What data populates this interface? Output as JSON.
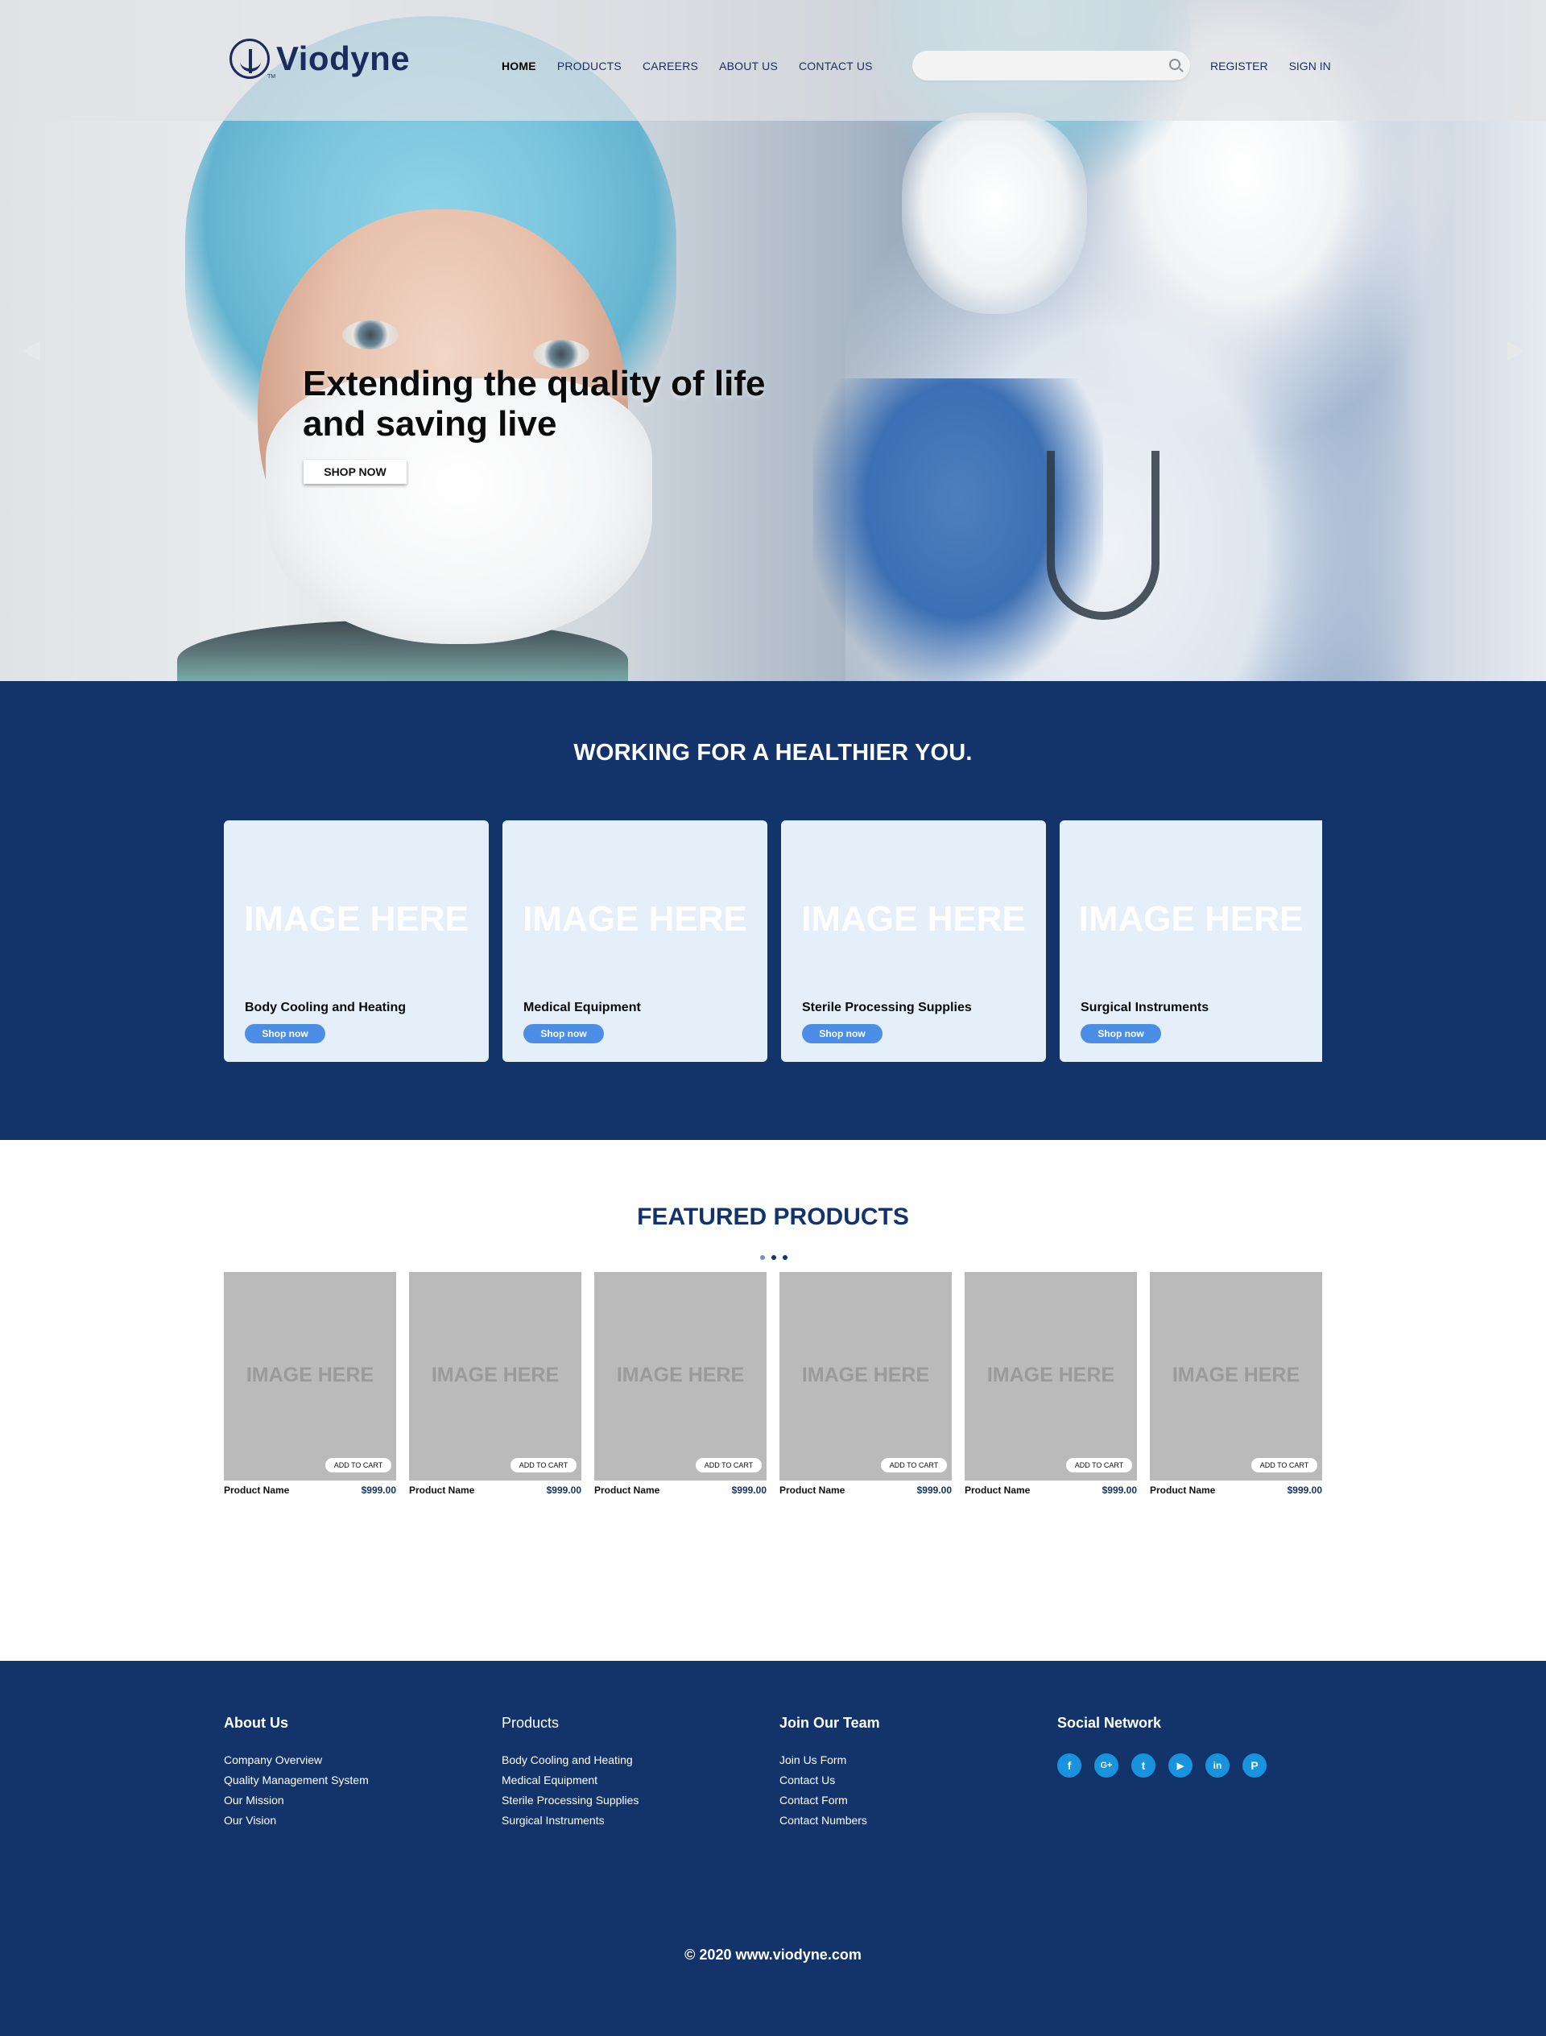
{
  "header": {
    "brand": "Viodyne",
    "nav": [
      "HOME",
      "PRODUCTS",
      "CAREERS",
      "ABOUT US",
      "CONTACT US"
    ],
    "search_placeholder": "",
    "register": "REGISTER",
    "sign_in": "SIGN IN"
  },
  "hero": {
    "title": "Extending the quality of life and saving live",
    "cta": "SHOP NOW"
  },
  "categories": {
    "heading": "WORKING FOR A HEALTHIER YOU.",
    "items": [
      {
        "image_text": "IMAGE HERE",
        "label": "Body Cooling and Heating",
        "button": "Shop now"
      },
      {
        "image_text": "IMAGE HERE",
        "label": "Medical Equipment",
        "button": "Shop now"
      },
      {
        "image_text": "IMAGE HERE",
        "label": "Sterile Processing Supplies",
        "button": "Shop now"
      },
      {
        "image_text": "IMAGE HERE",
        "label": "Surgical Instruments",
        "button": "Shop now"
      }
    ]
  },
  "featured": {
    "heading": "FEATURED PRODUCTS",
    "products": [
      {
        "image_text": "IMAGE HERE",
        "cart": "ADD TO CART",
        "name": "Product Name",
        "price": "$999.00"
      },
      {
        "image_text": "IMAGE HERE",
        "cart": "ADD TO CART",
        "name": "Product Name",
        "price": "$999.00"
      },
      {
        "image_text": "IMAGE HERE",
        "cart": "ADD TO CART",
        "name": "Product Name",
        "price": "$999.00"
      },
      {
        "image_text": "IMAGE HERE",
        "cart": "ADD TO CART",
        "name": "Product Name",
        "price": "$999.00"
      },
      {
        "image_text": "IMAGE HERE",
        "cart": "ADD TO CART",
        "name": "Product Name",
        "price": "$999.00"
      },
      {
        "image_text": "IMAGE HERE",
        "cart": "ADD TO CART",
        "name": "Product Name",
        "price": "$999.00"
      }
    ]
  },
  "footer": {
    "about": {
      "title": "About Us",
      "links": [
        "Company Overview",
        "Quality Management System",
        "Our Mission",
        "Our Vision"
      ]
    },
    "products": {
      "title": "Products",
      "links": [
        "Body Cooling and Heating",
        "Medical Equipment",
        "Sterile Processing Supplies",
        "Surgical Instruments"
      ]
    },
    "team": {
      "title": "Join Our Team",
      "links": [
        "Join Us Form",
        "Contact Us",
        "Contact Form",
        "Contact Numbers"
      ]
    },
    "social": {
      "title": "Social Network",
      "icons": [
        {
          "name": "facebook-icon",
          "glyph": "f"
        },
        {
          "name": "google-plus-icon",
          "glyph": "G+"
        },
        {
          "name": "twitter-icon",
          "glyph": "t"
        },
        {
          "name": "youtube-icon",
          "glyph": "▶"
        },
        {
          "name": "linkedin-icon",
          "glyph": "in"
        },
        {
          "name": "pinterest-icon",
          "glyph": "P"
        }
      ]
    },
    "copyright": "© 2020 www.viodyne.com"
  },
  "colors": {
    "navy": "#13346a",
    "card_bg": "#e4eff9",
    "accent_button": "#4c8ee6",
    "social_blue": "#1a93de",
    "placeholder_gray": "#bababa"
  }
}
